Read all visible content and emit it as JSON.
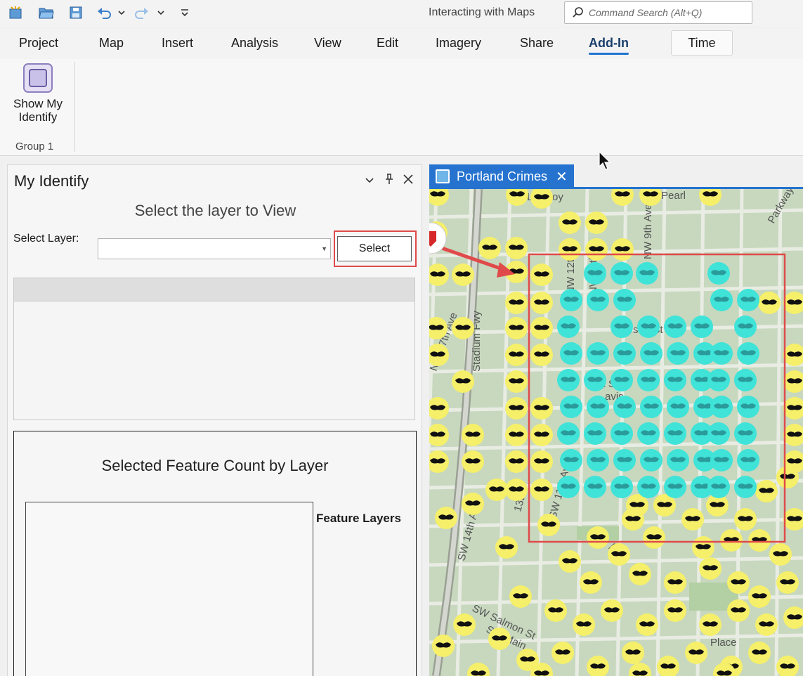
{
  "title_bar": {
    "doc_title": "Interacting with Maps",
    "search_placeholder": "Command Search (Alt+Q)",
    "qat_icons": [
      "new-project-icon",
      "open-project-icon",
      "save-project-icon",
      "undo-icon",
      "dropdown-icon",
      "redo-icon",
      "dropdown-icon",
      "customize-icon"
    ]
  },
  "ribbon_tabs": [
    {
      "label": "Project"
    },
    {
      "label": "Map"
    },
    {
      "label": "Insert"
    },
    {
      "label": "Analysis"
    },
    {
      "label": "View"
    },
    {
      "label": "Edit"
    },
    {
      "label": "Imagery"
    },
    {
      "label": "Share"
    },
    {
      "label": "Add-In",
      "active": true
    },
    {
      "label": "Time"
    }
  ],
  "ribbon": {
    "button_label": "Show My Identify",
    "group_label": "Group 1"
  },
  "pane": {
    "title": "My Identify",
    "heading": "Select the layer to View",
    "select_label": "Select Layer:",
    "select_value": "",
    "select_button": "Select",
    "chart_title": "Selected Feature Count by Layer",
    "legend_title": "Feature Layers"
  },
  "map": {
    "tab_label": "Portland Crimes",
    "street_labels": [
      "NW Lovejoy",
      "Pearl",
      "NW 9th Ave",
      "NW 11th",
      "Stadium Fwy",
      "NW 17th Ave",
      "san St",
      "NW",
      "ett St",
      "avis",
      "SW 14th Ave",
      "13th",
      "SW 11th Ave",
      "SW Salmon St",
      "SW Main",
      "SW A",
      "Place",
      "NW 12th A",
      "Parkway"
    ]
  },
  "colors": {
    "accent": "#2573cf",
    "selection_box": "#e04a4a",
    "crime_point": "#f5ef6a",
    "selected_point": "#3fe3d8"
  }
}
